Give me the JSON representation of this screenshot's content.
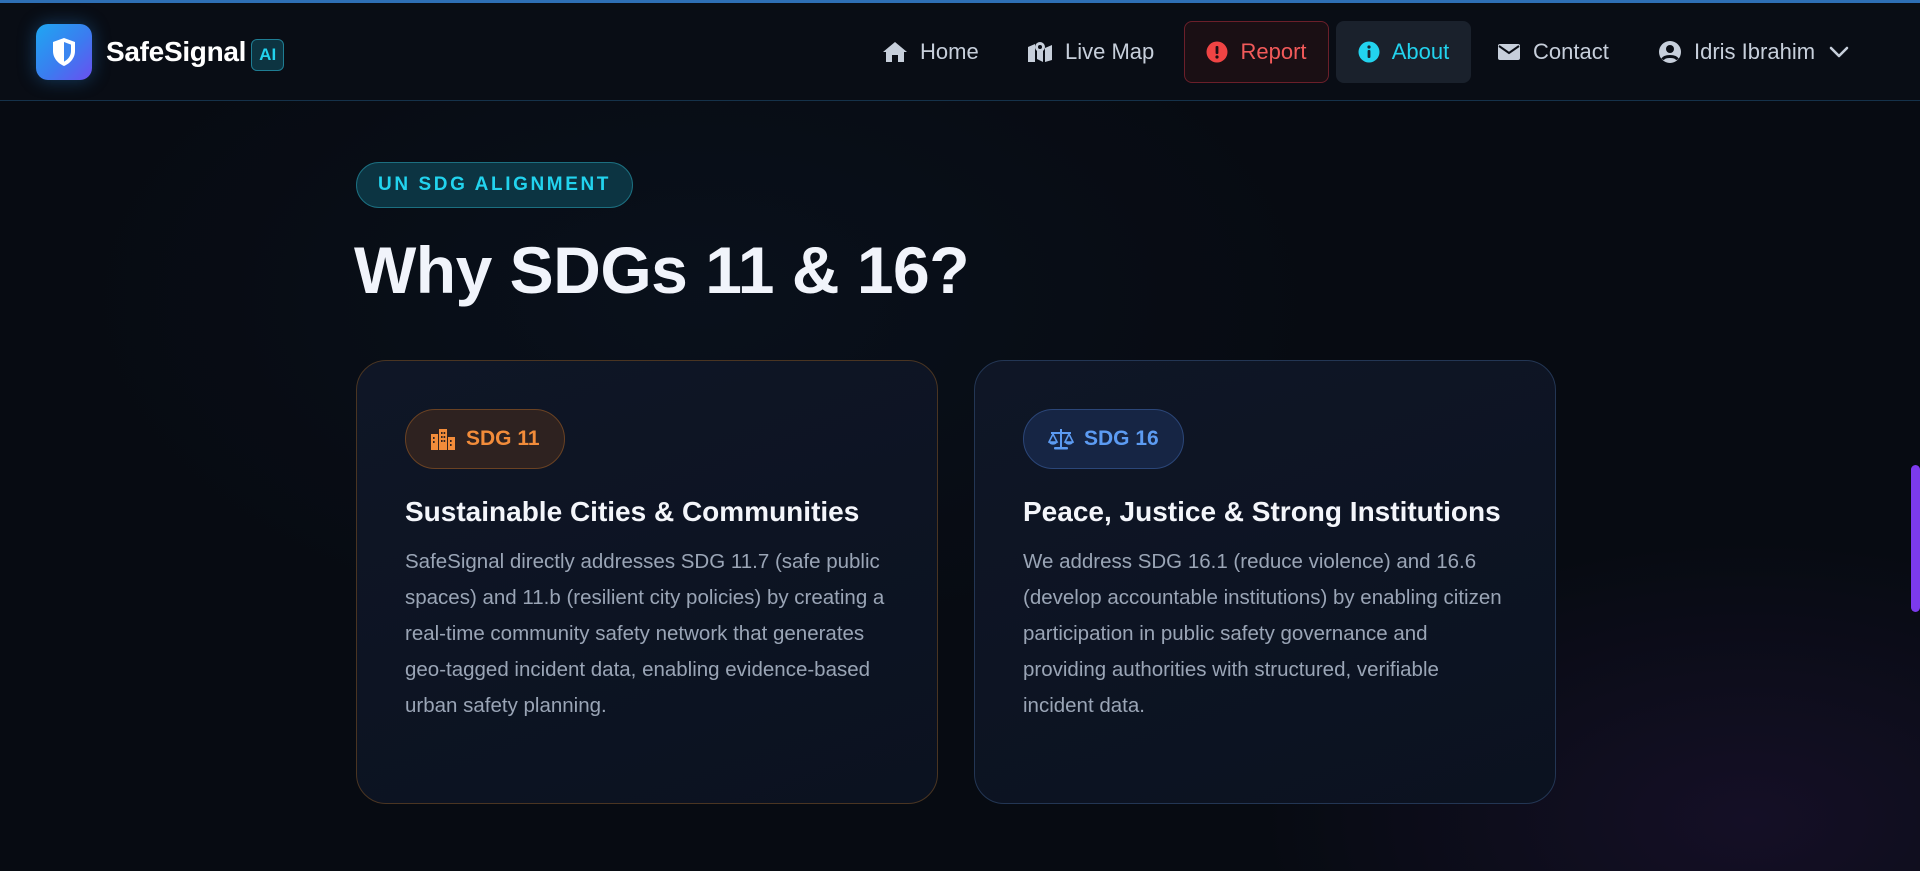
{
  "brand": {
    "name": "SafeSignal",
    "badge": "AI",
    "logo_icon": "shield-icon"
  },
  "nav": {
    "home": "Home",
    "live_map": "Live Map",
    "report": "Report",
    "about": "About",
    "contact": "Contact",
    "user": "Idris Ibrahim",
    "active": "About"
  },
  "section": {
    "eyebrow": "UN SDG ALIGNMENT",
    "heading": "Why SDGs 11 & 16?"
  },
  "cards": [
    {
      "badge": "SDG 11",
      "icon": "city-icon",
      "title": "Sustainable Cities & Communities",
      "body": "SafeSignal directly addresses SDG 11.7 (safe public spaces) and 11.b (resilient city policies) by creating a real-time community safety network that generates geo-tagged incident data, enabling evidence-based urban safety planning."
    },
    {
      "badge": "SDG 16",
      "icon": "scale-icon",
      "title": "Peace, Justice & Strong Institutions",
      "body": "We address SDG 16.1 (reduce violence) and 16.6 (develop accountable institutions) by enabling citizen participation in public safety governance and providing authorities with structured, verifiable incident data."
    }
  ],
  "colors": {
    "accent_cyan": "#22d3ee",
    "report_red": "#f25a5a",
    "sdg11_orange": "#f28c3a",
    "sdg16_blue": "#5c9bf2"
  }
}
